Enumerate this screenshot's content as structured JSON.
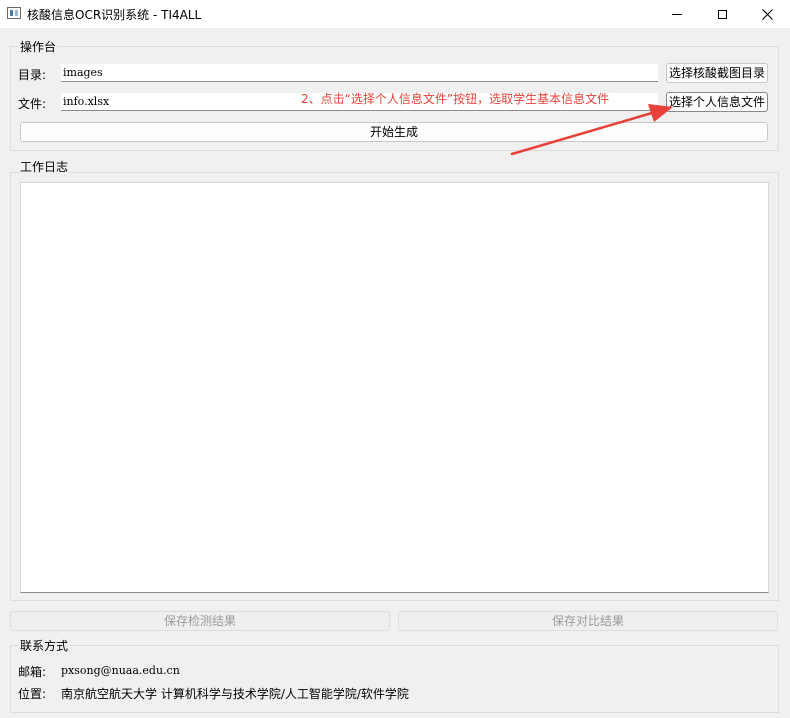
{
  "window": {
    "title": "核酸信息OCR识别系统 - TI4ALL",
    "icon": "app-icon"
  },
  "console": {
    "group_title": "操作台",
    "dir_label": "目录:",
    "dir_value": "images",
    "file_label": "文件:",
    "file_value": "info.xlsx",
    "select_dir_button": "选择核酸截图目录",
    "select_file_button": "选择个人信息文件",
    "start_button": "开始生成"
  },
  "annotation": {
    "text": "2、点击“选择个人信息文件”按钮，选取学生基本信息文件",
    "color": "#e8413a"
  },
  "log": {
    "group_title": "工作日志"
  },
  "actions": {
    "save_detect_button": "保存检测结果",
    "save_compare_button": "保存对比结果"
  },
  "contact": {
    "group_title": "联系方式",
    "email_label": "邮箱:",
    "email_value": "pxsong@nuaa.edu.cn",
    "location_label": "位置:",
    "location_value": "南京航空航天大学 计算机科学与技术学院/人工智能学院/软件学院"
  }
}
